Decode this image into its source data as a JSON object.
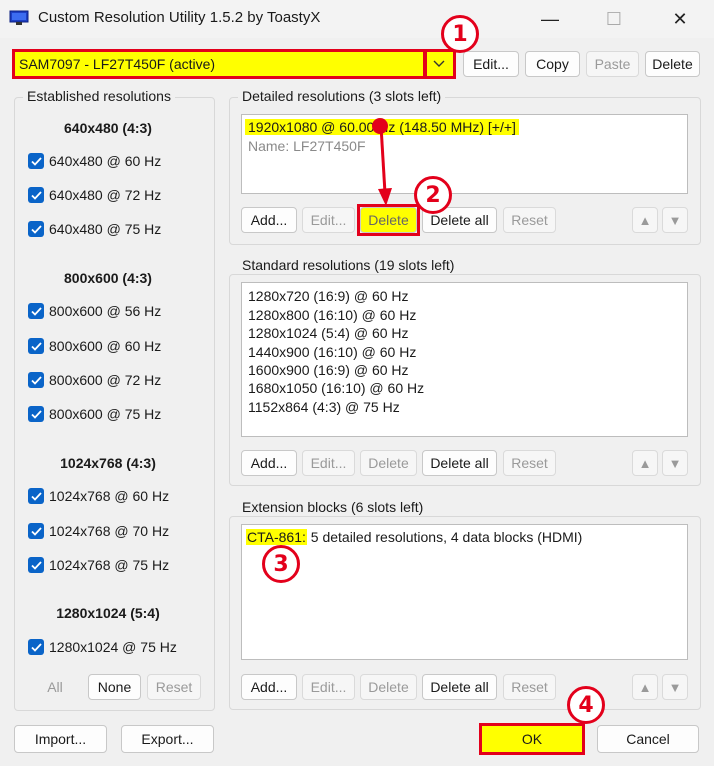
{
  "window": {
    "title": "Custom Resolution Utility 1.5.2 by ToastyX",
    "minimize": "—",
    "maximize": "☐",
    "close": "✕"
  },
  "monitor": {
    "selected": "SAM7097 - LF27T450F (active)",
    "buttons": {
      "edit": "Edit...",
      "copy": "Copy",
      "paste": "Paste",
      "delete": "Delete"
    }
  },
  "established": {
    "label": "Established resolutions",
    "groups": [
      {
        "heading": "640x480 (4:3)",
        "items": [
          "640x480 @ 60 Hz",
          "640x480 @ 72 Hz",
          "640x480 @ 75 Hz"
        ]
      },
      {
        "heading": "800x600 (4:3)",
        "items": [
          "800x600 @ 56 Hz",
          "800x600 @ 60 Hz",
          "800x600 @ 72 Hz",
          "800x600 @ 75 Hz"
        ]
      },
      {
        "heading": "1024x768 (4:3)",
        "items": [
          "1024x768 @ 60 Hz",
          "1024x768 @ 70 Hz",
          "1024x768 @ 75 Hz"
        ]
      },
      {
        "heading": "1280x1024 (5:4)",
        "items": [
          "1280x1024 @ 75 Hz"
        ]
      }
    ],
    "buttons": {
      "all": "All",
      "none": "None",
      "reset": "Reset"
    }
  },
  "detailed": {
    "label": "Detailed resolutions (3 slots left)",
    "entry": "1920x1080 @ 60.00 Hz (148.50 MHz) [+/+]",
    "name": "Name: LF27T450F",
    "buttons": {
      "add": "Add...",
      "edit": "Edit...",
      "delete": "Delete",
      "delete_all": "Delete all",
      "reset": "Reset"
    }
  },
  "standard": {
    "label": "Standard resolutions (19 slots left)",
    "items": [
      "1280x720 (16:9) @ 60 Hz",
      "1280x800 (16:10) @ 60 Hz",
      "1280x1024 (5:4) @ 60 Hz",
      "1440x900 (16:10) @ 60 Hz",
      "1600x900 (16:9) @ 60 Hz",
      "1680x1050 (16:10) @ 60 Hz",
      "1152x864 (4:3) @ 75 Hz"
    ],
    "buttons": {
      "add": "Add...",
      "edit": "Edit...",
      "delete": "Delete",
      "delete_all": "Delete all",
      "reset": "Reset"
    }
  },
  "extension": {
    "label": "Extension blocks (6 slots left)",
    "entry_key": "CTA-861:",
    "entry_text": " 5 detailed resolutions, 4 data blocks (HDMI)",
    "buttons": {
      "add": "Add...",
      "edit": "Edit...",
      "delete": "Delete",
      "delete_all": "Delete all",
      "reset": "Reset"
    }
  },
  "footer": {
    "import": "Import...",
    "export": "Export...",
    "ok": "OK",
    "cancel": "Cancel"
  },
  "arrows": {
    "up": "▲",
    "down": "▼"
  },
  "annotations": [
    "1",
    "2",
    "3",
    "4"
  ],
  "colors": {
    "highlight": "#ffff00",
    "annotation_red": "#e3001b",
    "checkbox_blue": "#0a64c8"
  }
}
